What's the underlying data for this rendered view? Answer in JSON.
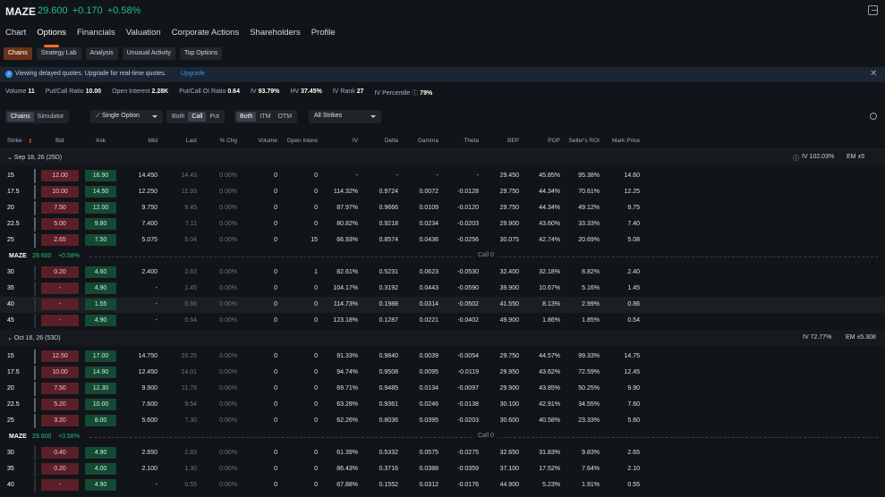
{
  "header": {
    "symbol": "MAZE",
    "price": "29.600",
    "change": "+0.170",
    "change_pct": "+0.58%"
  },
  "nav": [
    "Chart",
    "Options",
    "Financials",
    "Valuation",
    "Corporate Actions",
    "Shareholders",
    "Profile"
  ],
  "subtabs": [
    "Chains",
    "Strategy Lab",
    "Analysis",
    "Unusual Activity",
    "Top Options"
  ],
  "banner": {
    "text": "Viewing delayed quotes. Upgrade for real-time quotes.",
    "link": "Upgrade"
  },
  "stats": [
    {
      "label": "Volume",
      "value": "11"
    },
    {
      "label": "Put/Call Ratio",
      "value": "10.00"
    },
    {
      "label": "Open Interest",
      "value": "2.28K"
    },
    {
      "label": "Put/Call OI Ratio",
      "value": "0.64"
    },
    {
      "label": "IV",
      "value": "93.79%"
    },
    {
      "label": "HV",
      "value": "37.45%"
    },
    {
      "label": "IV Rank",
      "value": "27"
    },
    {
      "label": "IV Percentile ⓘ",
      "value": "79%"
    }
  ],
  "controls": {
    "mode": [
      "Chains",
      "Simulator"
    ],
    "strategy": "Single Option",
    "side": [
      "Both",
      "Call",
      "Put"
    ],
    "money": [
      "Both",
      "ITM",
      "OTM"
    ],
    "strikes": "All Strikes"
  },
  "columns": [
    "Strike",
    "Bid",
    "Ask",
    "Mid",
    "Last",
    "% Chg",
    "Volume",
    "Open Intere",
    "IV",
    "Delta",
    "Gamma",
    "Theta",
    "BEP",
    "POP",
    "Seller's ROI",
    "Mark Price"
  ],
  "spot": {
    "symbol": "MAZE",
    "price": "29.600",
    "change": "+0.58%",
    "label": "Call 0"
  },
  "groups": [
    {
      "expiry": "Sep 18, 26 (25D)",
      "iv": "IV 102.03%",
      "em": "EM ±5",
      "rows": [
        [
          "15",
          "12.00",
          "16.90",
          "14.450",
          "14.43",
          "0.00%",
          "0",
          "0",
          "-",
          "-",
          "-",
          "-",
          "29.450",
          "45.85%",
          "95.38%",
          "14.60"
        ],
        [
          "17.5",
          "10.00",
          "14.50",
          "12.250",
          "11.93",
          "0.00%",
          "0",
          "0",
          "114.32%",
          "0.9724",
          "0.0072",
          "-0.0128",
          "29.750",
          "44.34%",
          "70.61%",
          "12.25"
        ],
        [
          "20",
          "7.50",
          "12.00",
          "9.750",
          "9.45",
          "0.00%",
          "0",
          "0",
          "87.97%",
          "0.9666",
          "0.0109",
          "-0.0120",
          "29.750",
          "44.34%",
          "49.12%",
          "9.75"
        ],
        [
          "22.5",
          "5.00",
          "9.80",
          "7.400",
          "7.11",
          "0.00%",
          "0",
          "0",
          "80.82%",
          "0.9218",
          "0.0234",
          "-0.0203",
          "29.900",
          "43.60%",
          "33.33%",
          "7.40"
        ],
        [
          "25",
          "2.65",
          "7.50",
          "5.075",
          "5.04",
          "0.00%",
          "0",
          "15",
          "66.93%",
          "0.8574",
          "0.0436",
          "-0.0256",
          "30.075",
          "42.74%",
          "20.69%",
          "5.08"
        ]
      ],
      "otm": [
        [
          "30",
          "0.20",
          "4.60",
          "2.400",
          "2.63",
          "0.00%",
          "0",
          "1",
          "82.61%",
          "0.5231",
          "0.0623",
          "-0.0530",
          "32.400",
          "32.18%",
          "8.82%",
          "2.40"
        ],
        [
          "35",
          "-",
          "4.90",
          "-",
          "1.45",
          "0.00%",
          "0",
          "0",
          "104.17%",
          "0.3192",
          "0.0443",
          "-0.0590",
          "39.900",
          "10.67%",
          "5.16%",
          "1.45"
        ],
        [
          "40",
          "-",
          "1.55",
          "-",
          "0.86",
          "0.00%",
          "0",
          "0",
          "114.73%",
          "0.1988",
          "0.0314",
          "-0.0502",
          "41.550",
          "8.13%",
          "2.99%",
          "0.86"
        ],
        [
          "45",
          "-",
          "4.90",
          "-",
          "0.54",
          "0.00%",
          "0",
          "0",
          "123.18%",
          "0.1287",
          "0.0221",
          "-0.0402",
          "49.900",
          "1.86%",
          "1.85%",
          "0.54"
        ]
      ]
    },
    {
      "expiry": "Oct 16, 26 (53D)",
      "iv": "IV 72.77%",
      "em": "EM ±5.308",
      "rows": [
        [
          "15",
          "12.50",
          "17.00",
          "14.750",
          "16.25",
          "0.00%",
          "0",
          "0",
          "91.33%",
          "0.9840",
          "0.0039",
          "-0.0054",
          "29.750",
          "44.57%",
          "99.33%",
          "14.75"
        ],
        [
          "17.5",
          "10.00",
          "14.90",
          "12.450",
          "14.01",
          "0.00%",
          "0",
          "0",
          "94.74%",
          "0.9508",
          "0.0095",
          "-0.0119",
          "29.950",
          "43.62%",
          "72.59%",
          "12.45"
        ],
        [
          "20",
          "7.50",
          "12.30",
          "9.900",
          "11.78",
          "0.00%",
          "0",
          "0",
          "69.71%",
          "0.9485",
          "0.0134",
          "-0.0097",
          "29.900",
          "43.85%",
          "50.25%",
          "9.90"
        ],
        [
          "22.5",
          "5.20",
          "10.00",
          "7.600",
          "9.54",
          "0.00%",
          "0",
          "0",
          "63.28%",
          "0.9361",
          "0.0246",
          "-0.0138",
          "30.100",
          "42.91%",
          "34.55%",
          "7.60"
        ],
        [
          "25",
          "3.20",
          "8.00",
          "5.600",
          "7.30",
          "0.00%",
          "0",
          "0",
          "62.26%",
          "0.8036",
          "0.0395",
          "-0.0203",
          "30.600",
          "40.58%",
          "23.33%",
          "5.60"
        ]
      ],
      "otm": [
        [
          "30",
          "0.40",
          "4.90",
          "2.650",
          "2.83",
          "0.00%",
          "0",
          "0",
          "61.39%",
          "0.5332",
          "0.0575",
          "-0.0275",
          "32.650",
          "31.83%",
          "9.83%",
          "2.65"
        ],
        [
          "35",
          "0.20",
          "4.00",
          "2.100",
          "1.30",
          "0.00%",
          "0",
          "0",
          "86.43%",
          "0.3716",
          "0.0388",
          "-0.0359",
          "37.100",
          "17.52%",
          "7.64%",
          "2.10"
        ],
        [
          "40",
          "-",
          "4.90",
          "-",
          "0.55",
          "0.00%",
          "0",
          "0",
          "67.88%",
          "0.1552",
          "0.0312",
          "-0.0176",
          "44.900",
          "5.23%",
          "1.91%",
          "0.55"
        ]
      ]
    }
  ],
  "colors": {
    "up": "#22c17a",
    "accent": "#f26c2b",
    "bid_bg": "#5a1f27",
    "ask_bg": "#134a33",
    "link": "#3d8fe8"
  }
}
